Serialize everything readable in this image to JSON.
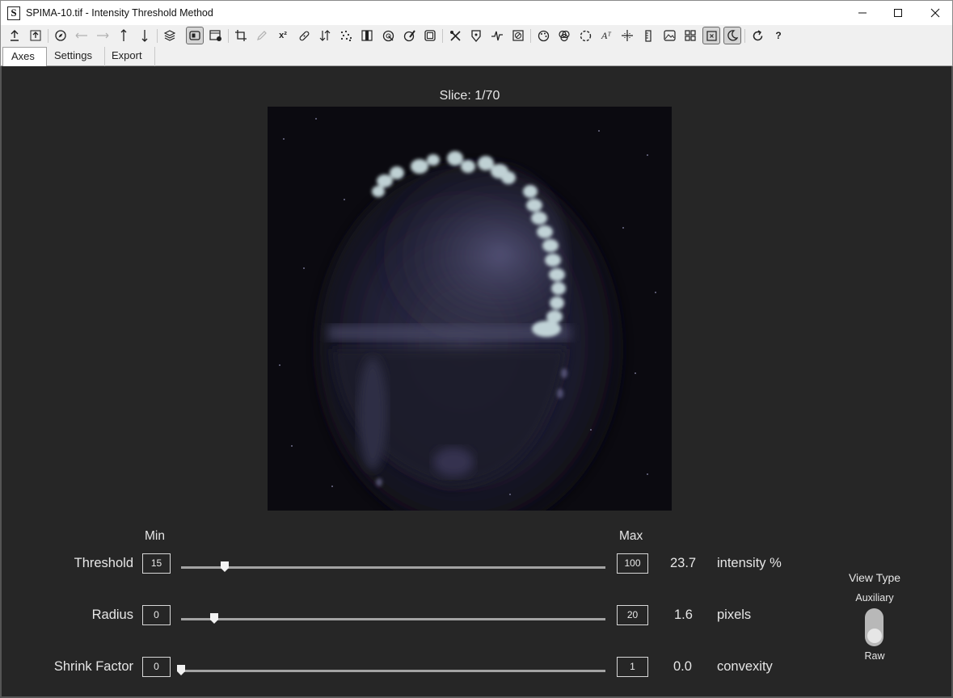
{
  "window": {
    "app_icon_letter": "S",
    "title": "SPIMA-10.tif - Intensity Threshold Method",
    "controls": [
      "minimize",
      "maximize",
      "close"
    ]
  },
  "toolbar": {
    "icons": [
      "upload-icon",
      "upload-box-icon",
      "compass-icon",
      "arrow-left-icon",
      "arrow-right-icon",
      "arrow-up-icon",
      "arrow-down-icon",
      "layers-icon",
      "panel-active-icon",
      "window-settings-icon",
      "crop-icon",
      "pencil-icon",
      "superscript-icon",
      "bandage-icon",
      "sort-icon",
      "scatter-dots-icon",
      "split-view-icon",
      "circle-scan-icon",
      "brush-circle-icon",
      "frame-icon",
      "tools-icon",
      "shield-icon",
      "waveform-icon",
      "circle-slash-icon",
      "palette-icon",
      "rgb-circles-icon",
      "dashed-circle-icon",
      "text-a-icon",
      "crosshair-icon",
      "ruler-icon",
      "image-icon",
      "grid-icon",
      "close-box-icon",
      "moon-icon",
      "refresh-icon",
      "help-icon"
    ],
    "superscript_label": "x²",
    "help_label": "?"
  },
  "tabs": [
    {
      "label": "Axes",
      "active": true
    },
    {
      "label": "Settings",
      "active": false
    },
    {
      "label": "Export",
      "active": false
    }
  ],
  "viewer": {
    "slice_label": "Slice: 1/70",
    "current_slice": 1,
    "total_slices": 70
  },
  "controls": {
    "min_header": "Min",
    "max_header": "Max",
    "rows": [
      {
        "label": "Threshold",
        "min": "15",
        "max": "100",
        "value": "23.7",
        "unit": "intensity %",
        "slider_fraction": 0.103
      },
      {
        "label": "Radius",
        "min": "0",
        "max": "20",
        "value": "1.6",
        "unit": "pixels",
        "slider_fraction": 0.08
      },
      {
        "label": "Shrink Factor",
        "min": "0",
        "max": "1",
        "value": "0.0",
        "unit": "convexity",
        "slider_fraction": 0.0
      }
    ]
  },
  "view_type": {
    "title": "View Type",
    "option_top": "Auxiliary",
    "option_bottom": "Raw",
    "selected": "Raw"
  }
}
